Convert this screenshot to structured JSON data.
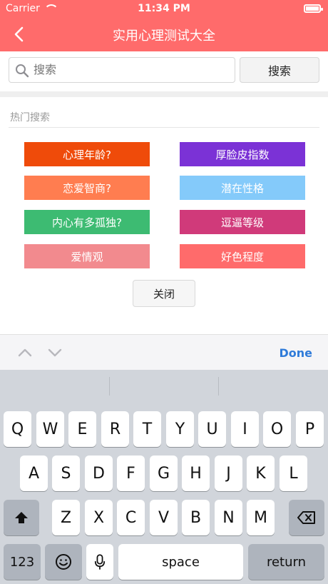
{
  "status": {
    "carrier": "Carrier",
    "time": "11:34 PM"
  },
  "nav": {
    "title": "实用心理测试大全"
  },
  "search": {
    "placeholder": "搜索",
    "button_label": "搜索"
  },
  "hot": {
    "title": "热门搜索",
    "tags": [
      {
        "label": "心理年龄?",
        "color": "#ef4b0a"
      },
      {
        "label": "厚脸皮指数",
        "color": "#7b32d6"
      },
      {
        "label": "恋爱智商?",
        "color": "#ff7d50"
      },
      {
        "label": "潜在性格",
        "color": "#84cafa"
      },
      {
        "label": "内心有多孤独?",
        "color": "#3dbb72"
      },
      {
        "label": "逗逼等级",
        "color": "#d03a7a"
      },
      {
        "label": "爱情观",
        "color": "#f28a8e"
      },
      {
        "label": "好色程度",
        "color": "#ff6b6b"
      }
    ],
    "close_label": "关闭"
  },
  "accessory": {
    "done_label": "Done"
  },
  "keyboard": {
    "row1": [
      "Q",
      "W",
      "E",
      "R",
      "T",
      "Y",
      "U",
      "I",
      "O",
      "P"
    ],
    "row2": [
      "A",
      "S",
      "D",
      "F",
      "G",
      "H",
      "J",
      "K",
      "L"
    ],
    "row3": [
      "Z",
      "X",
      "C",
      "V",
      "B",
      "N",
      "M"
    ],
    "numbers_label": "123",
    "space_label": "space",
    "return_label": "return"
  },
  "colors": {
    "nav_bg": "#ff6b6b",
    "done_blue": "#2f7bd9"
  }
}
